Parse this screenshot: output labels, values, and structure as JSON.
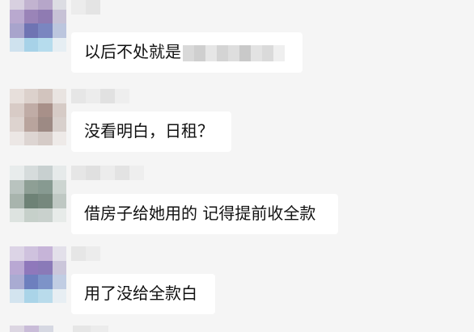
{
  "messages": [
    {
      "text": "以后不处就是",
      "redacted": true
    },
    {
      "text": "没看明白，日租？",
      "redacted": false
    },
    {
      "text": "借房子给她用的 记得提前收全款",
      "redacted": false
    },
    {
      "text": "用了没给全款白",
      "redacted": false
    }
  ],
  "colors": {
    "background": "#f5f5f5",
    "bubble": "#ffffff",
    "text": "#111111"
  },
  "icons": [
    "avatar-blurred",
    "name-blurred",
    "redaction-blur"
  ]
}
